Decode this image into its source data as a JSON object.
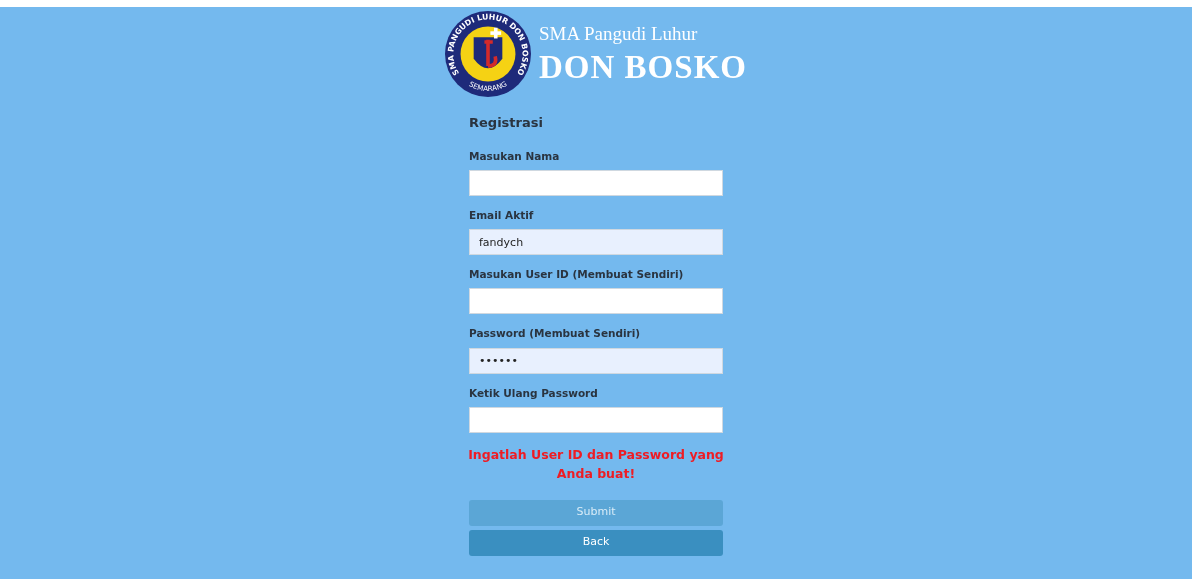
{
  "header": {
    "logo_ring_text": "SMA PANGUDI LUHUR DON BOSKO",
    "logo_bottom_text": "SEMARANG",
    "subtitle": "SMA Pangudi Luhur",
    "title": "DON BOSKO"
  },
  "form": {
    "heading": "Registrasi",
    "fields": [
      {
        "label": "Masukan Nama",
        "autofilled": false
      },
      {
        "label": "Email Aktif",
        "value": "fandych",
        "autofilled": true
      },
      {
        "label": "Masukan User ID (Membuat Sendiri)",
        "autofilled": false
      },
      {
        "label": "Password (Membuat Sendiri)",
        "value": "••••••",
        "autofilled": true
      },
      {
        "label": "Ketik Ulang Password",
        "autofilled": false
      }
    ],
    "warning": "Ingatlah User ID dan Password yang Anda buat!",
    "buttons": [
      {
        "label": "Submit",
        "disabled": true
      },
      {
        "label": "Back",
        "disabled": false
      }
    ]
  }
}
